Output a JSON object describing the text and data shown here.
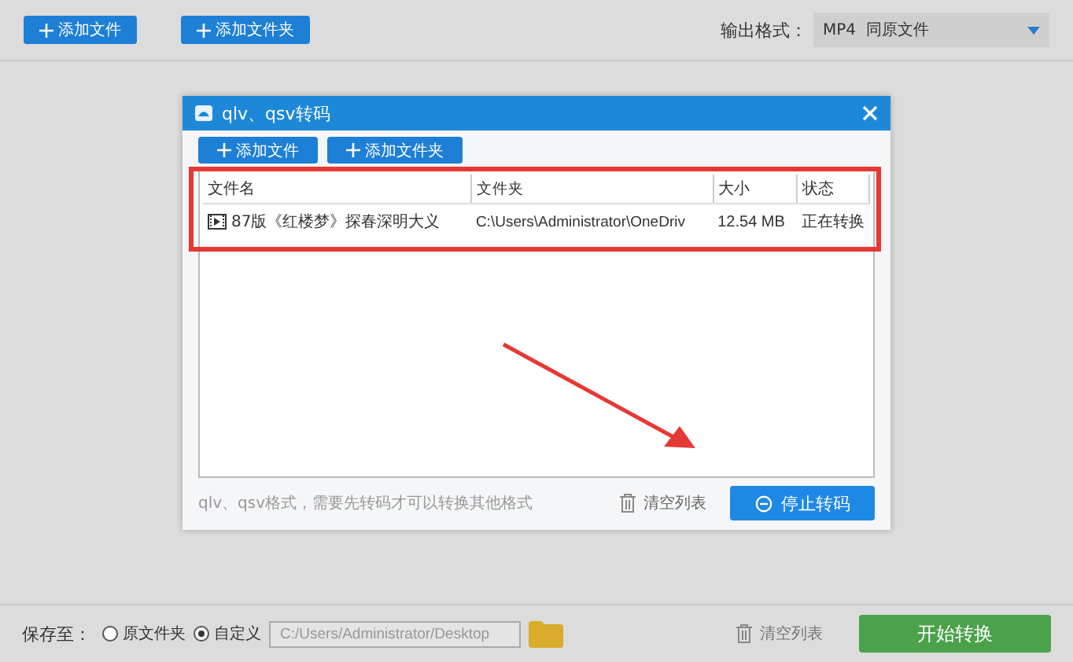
{
  "toolbar": {
    "buttons": [
      "添加文件",
      "添加文件夹"
    ],
    "output_format": {
      "label": "输出格式：",
      "value": "MP4  同原文件"
    }
  },
  "dialog": {
    "title": "qlv、qsv转码",
    "buttons": [
      "添加文件",
      "添加文件夹"
    ],
    "table": {
      "columns": [
        "文件名",
        "文件夹",
        "大小",
        "状态"
      ],
      "rows": [
        {
          "name": "87版《红楼梦》探春深明大义",
          "folder": "C:\\Users\\Administrator\\OneDriv",
          "size": "12.54 MB",
          "status": "正在转换"
        }
      ]
    },
    "hint": "qlv、qsv格式，需要先转码才可以转换其他格式",
    "clear": "清空列表",
    "stop": "停止转码"
  },
  "bottom": {
    "label": "保存至：",
    "options": [
      {
        "label": "原文件夹",
        "selected": false
      },
      {
        "label": "自定义",
        "selected": true
      }
    ],
    "path": "C:/Users/Administrator/Desktop",
    "clear": "清空列表",
    "start": "开始转换"
  }
}
